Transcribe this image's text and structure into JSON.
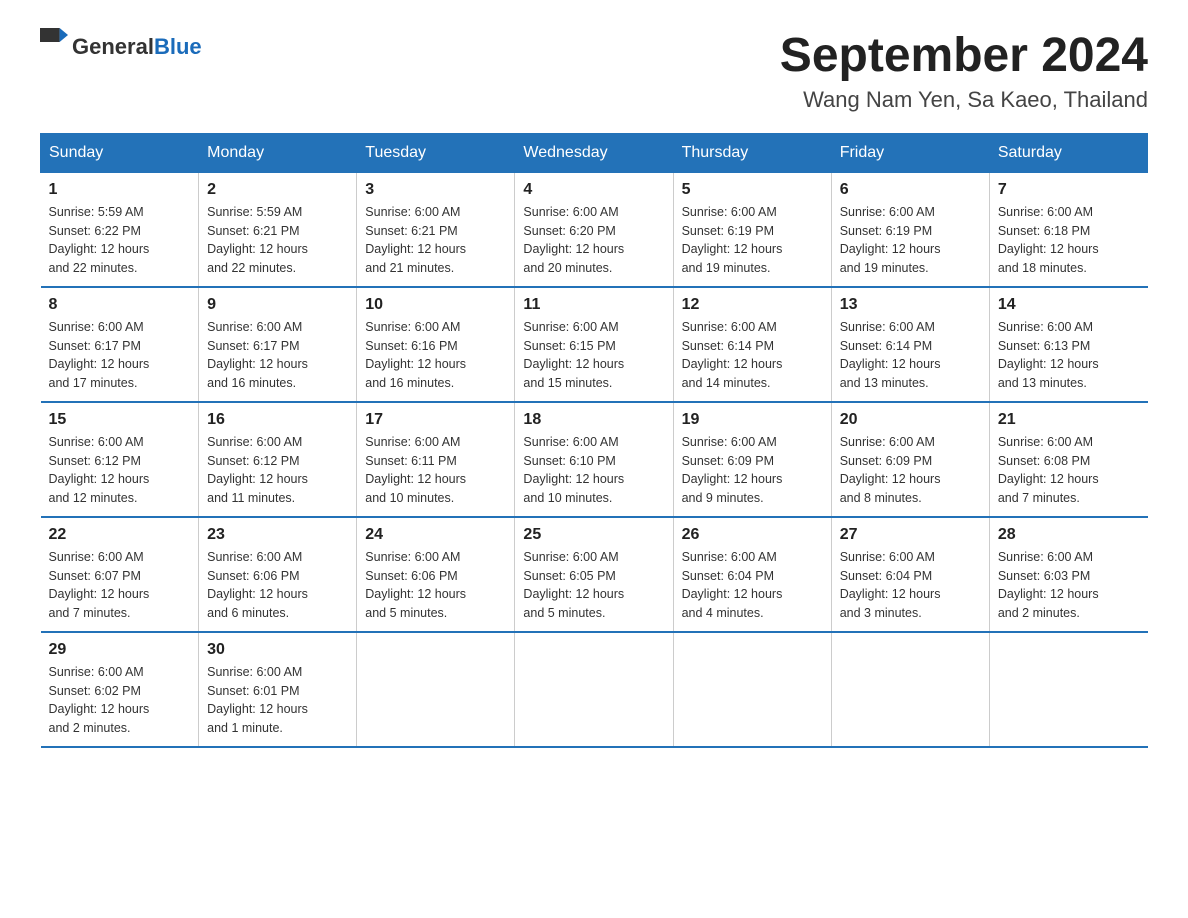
{
  "logo": {
    "general": "General",
    "blue": "Blue"
  },
  "title": "September 2024",
  "subtitle": "Wang Nam Yen, Sa Kaeo, Thailand",
  "headers": [
    "Sunday",
    "Monday",
    "Tuesday",
    "Wednesday",
    "Thursday",
    "Friday",
    "Saturday"
  ],
  "weeks": [
    [
      {
        "day": "1",
        "sunrise": "5:59 AM",
        "sunset": "6:22 PM",
        "daylight": "12 hours and 22 minutes."
      },
      {
        "day": "2",
        "sunrise": "5:59 AM",
        "sunset": "6:21 PM",
        "daylight": "12 hours and 22 minutes."
      },
      {
        "day": "3",
        "sunrise": "6:00 AM",
        "sunset": "6:21 PM",
        "daylight": "12 hours and 21 minutes."
      },
      {
        "day": "4",
        "sunrise": "6:00 AM",
        "sunset": "6:20 PM",
        "daylight": "12 hours and 20 minutes."
      },
      {
        "day": "5",
        "sunrise": "6:00 AM",
        "sunset": "6:19 PM",
        "daylight": "12 hours and 19 minutes."
      },
      {
        "day": "6",
        "sunrise": "6:00 AM",
        "sunset": "6:19 PM",
        "daylight": "12 hours and 19 minutes."
      },
      {
        "day": "7",
        "sunrise": "6:00 AM",
        "sunset": "6:18 PM",
        "daylight": "12 hours and 18 minutes."
      }
    ],
    [
      {
        "day": "8",
        "sunrise": "6:00 AM",
        "sunset": "6:17 PM",
        "daylight": "12 hours and 17 minutes."
      },
      {
        "day": "9",
        "sunrise": "6:00 AM",
        "sunset": "6:17 PM",
        "daylight": "12 hours and 16 minutes."
      },
      {
        "day": "10",
        "sunrise": "6:00 AM",
        "sunset": "6:16 PM",
        "daylight": "12 hours and 16 minutes."
      },
      {
        "day": "11",
        "sunrise": "6:00 AM",
        "sunset": "6:15 PM",
        "daylight": "12 hours and 15 minutes."
      },
      {
        "day": "12",
        "sunrise": "6:00 AM",
        "sunset": "6:14 PM",
        "daylight": "12 hours and 14 minutes."
      },
      {
        "day": "13",
        "sunrise": "6:00 AM",
        "sunset": "6:14 PM",
        "daylight": "12 hours and 13 minutes."
      },
      {
        "day": "14",
        "sunrise": "6:00 AM",
        "sunset": "6:13 PM",
        "daylight": "12 hours and 13 minutes."
      }
    ],
    [
      {
        "day": "15",
        "sunrise": "6:00 AM",
        "sunset": "6:12 PM",
        "daylight": "12 hours and 12 minutes."
      },
      {
        "day": "16",
        "sunrise": "6:00 AM",
        "sunset": "6:12 PM",
        "daylight": "12 hours and 11 minutes."
      },
      {
        "day": "17",
        "sunrise": "6:00 AM",
        "sunset": "6:11 PM",
        "daylight": "12 hours and 10 minutes."
      },
      {
        "day": "18",
        "sunrise": "6:00 AM",
        "sunset": "6:10 PM",
        "daylight": "12 hours and 10 minutes."
      },
      {
        "day": "19",
        "sunrise": "6:00 AM",
        "sunset": "6:09 PM",
        "daylight": "12 hours and 9 minutes."
      },
      {
        "day": "20",
        "sunrise": "6:00 AM",
        "sunset": "6:09 PM",
        "daylight": "12 hours and 8 minutes."
      },
      {
        "day": "21",
        "sunrise": "6:00 AM",
        "sunset": "6:08 PM",
        "daylight": "12 hours and 7 minutes."
      }
    ],
    [
      {
        "day": "22",
        "sunrise": "6:00 AM",
        "sunset": "6:07 PM",
        "daylight": "12 hours and 7 minutes."
      },
      {
        "day": "23",
        "sunrise": "6:00 AM",
        "sunset": "6:06 PM",
        "daylight": "12 hours and 6 minutes."
      },
      {
        "day": "24",
        "sunrise": "6:00 AM",
        "sunset": "6:06 PM",
        "daylight": "12 hours and 5 minutes."
      },
      {
        "day": "25",
        "sunrise": "6:00 AM",
        "sunset": "6:05 PM",
        "daylight": "12 hours and 5 minutes."
      },
      {
        "day": "26",
        "sunrise": "6:00 AM",
        "sunset": "6:04 PM",
        "daylight": "12 hours and 4 minutes."
      },
      {
        "day": "27",
        "sunrise": "6:00 AM",
        "sunset": "6:04 PM",
        "daylight": "12 hours and 3 minutes."
      },
      {
        "day": "28",
        "sunrise": "6:00 AM",
        "sunset": "6:03 PM",
        "daylight": "12 hours and 2 minutes."
      }
    ],
    [
      {
        "day": "29",
        "sunrise": "6:00 AM",
        "sunset": "6:02 PM",
        "daylight": "12 hours and 2 minutes."
      },
      {
        "day": "30",
        "sunrise": "6:00 AM",
        "sunset": "6:01 PM",
        "daylight": "12 hours and 1 minute."
      },
      null,
      null,
      null,
      null,
      null
    ]
  ],
  "sunrise_label": "Sunrise:",
  "sunset_label": "Sunset:",
  "daylight_label": "Daylight:"
}
